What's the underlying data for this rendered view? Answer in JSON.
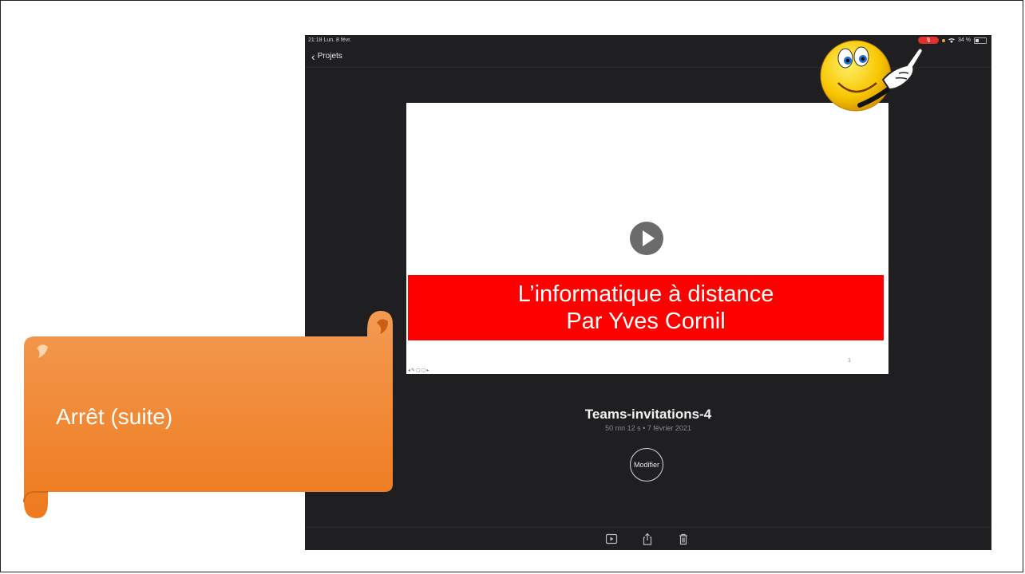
{
  "status_bar": {
    "time": "21:18  Lun. 8 févr.",
    "battery": "34 %"
  },
  "nav": {
    "back_label": "Projets"
  },
  "preview": {
    "title_line1": "L’informatique à distance",
    "title_line2": "Par Yves Cornil",
    "page_number": "1"
  },
  "project": {
    "title": "Teams-invitations-4",
    "meta": "50 mn 12 s • 7 février 2021",
    "modify_label": "Modifier"
  },
  "toolbar": {
    "icons": [
      "play-icon",
      "share-icon",
      "trash-icon"
    ]
  },
  "callout": {
    "text": "Arrêt (suite)"
  },
  "colors": {
    "banner": "#ff0000",
    "scroll_orange": "#f28a3c",
    "ipad_bg": "#1f1f21",
    "mic_pill": "#e0302b"
  }
}
